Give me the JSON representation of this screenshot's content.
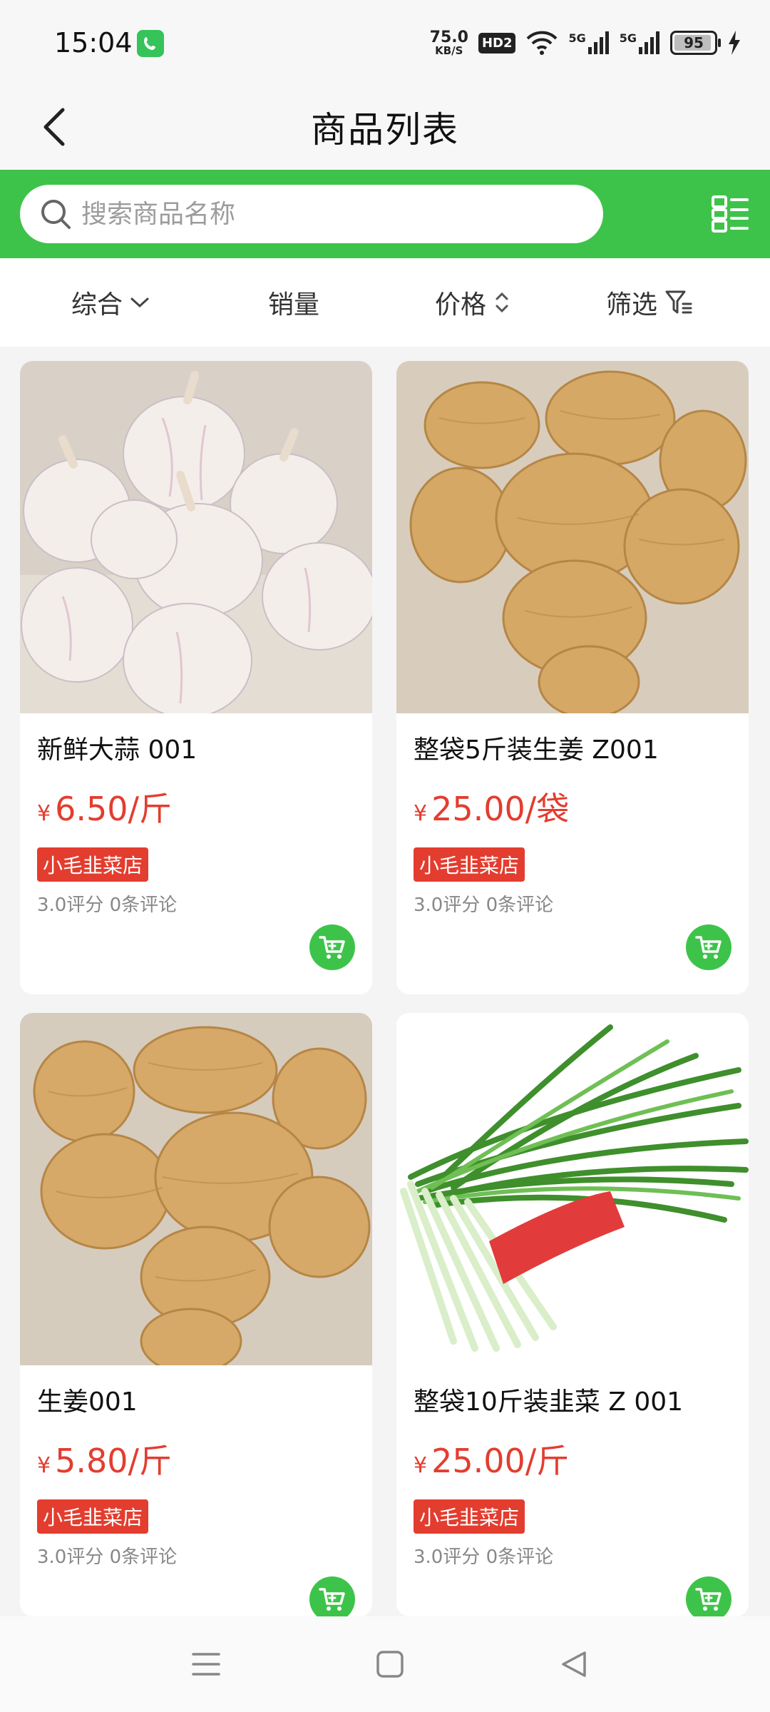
{
  "status_bar": {
    "time": "15:04",
    "net_speed_value": "75.0",
    "net_speed_unit": "KB/S",
    "hd_label": "HD2",
    "signal1_label": "5G",
    "signal2_label": "5G",
    "battery_percent": "95",
    "battery_level": 0.95
  },
  "header": {
    "title": "商品列表",
    "back_icon": "chevron-left-icon"
  },
  "search": {
    "placeholder": "搜索商品名称",
    "icon": "search-icon",
    "toggle_icon": "grid-list-icon"
  },
  "sort_bar": {
    "items": [
      {
        "label": "综合",
        "icon": "chevron-down-icon"
      },
      {
        "label": "销量"
      },
      {
        "label": "价格",
        "icon": "sort-updown-icon"
      },
      {
        "label": "筛选",
        "icon": "filter-icon"
      }
    ]
  },
  "products": [
    {
      "name": "新鲜大蒜 001",
      "currency": "¥",
      "price": "6.50/斤",
      "shop": "小毛韭菜店",
      "meta": "3.0评分 0条评论",
      "image": "garlic"
    },
    {
      "name": "整袋5斤装生姜 Z001",
      "currency": "¥",
      "price": "25.00/袋",
      "shop": "小毛韭菜店",
      "meta": "3.0评分 0条评论",
      "image": "ginger"
    },
    {
      "name": "生姜001",
      "currency": "¥",
      "price": "5.80/斤",
      "shop": "小毛韭菜店",
      "meta": "3.0评分 0条评论",
      "image": "ginger"
    },
    {
      "name": "整袋10斤装韭菜 Z 001",
      "currency": "¥",
      "price": "25.00/斤",
      "shop": "小毛韭菜店",
      "meta": "3.0评分 0条评论",
      "image": "chives"
    }
  ],
  "colors": {
    "brand_green": "#3ec34a",
    "price_red": "#e33d2f"
  },
  "nav_bar": {
    "icons": [
      "menu-icon",
      "home-square-icon",
      "back-triangle-icon"
    ]
  }
}
